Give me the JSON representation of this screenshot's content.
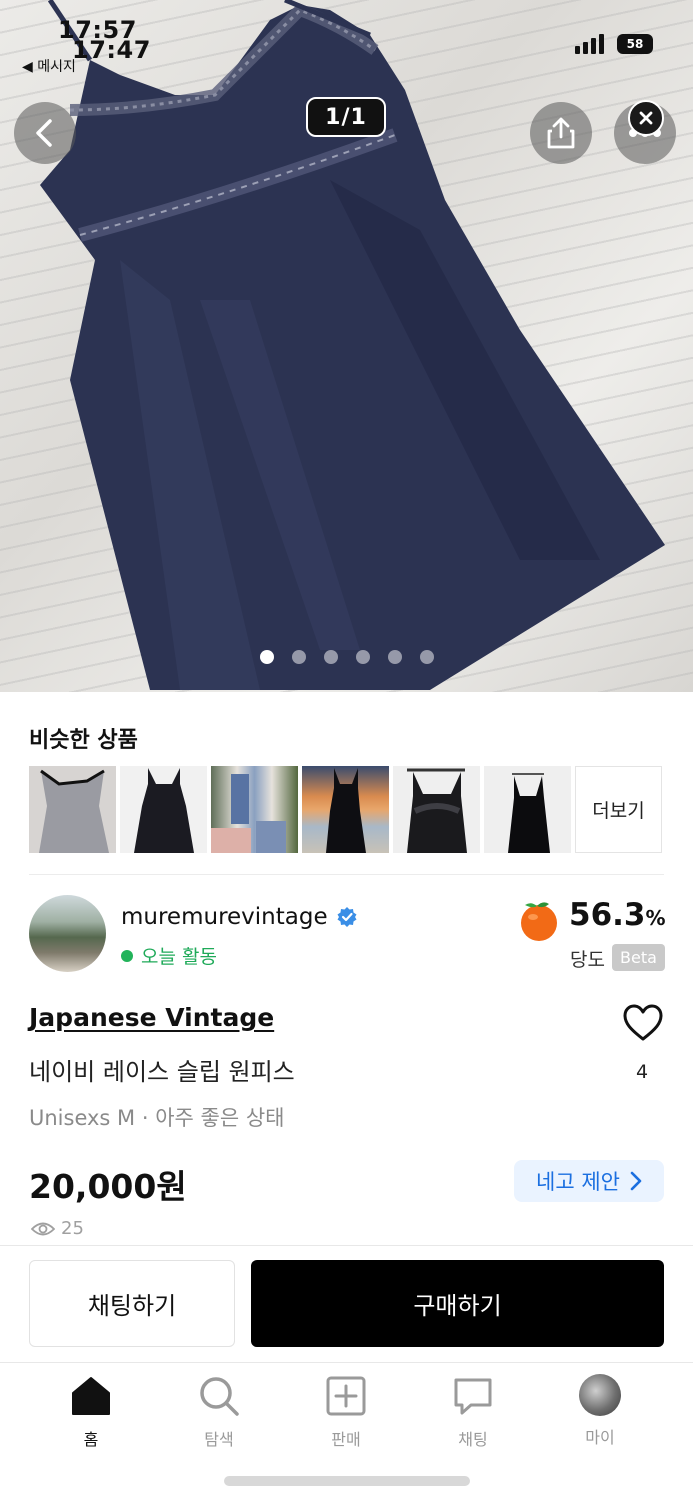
{
  "status_bar": {
    "time_primary": "17:57",
    "time_secondary": "17:47",
    "back_app": "◀ 메시지",
    "battery": "58"
  },
  "gallery": {
    "counter": "1/1",
    "total_dots": 6,
    "active_dot": 1
  },
  "similar": {
    "title": "비슷한 상품",
    "more_label": "더보기",
    "thumbs": [
      {
        "name": "grey-lace-slip"
      },
      {
        "name": "black-slip-dress"
      },
      {
        "name": "blue-outfits"
      },
      {
        "name": "black-dress-beach"
      },
      {
        "name": "black-lace-top"
      },
      {
        "name": "black-cami-dress"
      }
    ]
  },
  "seller": {
    "name": "muremurevintage",
    "activity": "오늘 활동",
    "score": "56.3",
    "score_unit": "%",
    "score_label": "당도",
    "beta": "Beta"
  },
  "product": {
    "brand": "Japanese Vintage",
    "name": "네이비 레이스 슬립 원피스",
    "meta": "Unisexs M · 아주 좋은 상태",
    "price": "20,000원",
    "likes": "4",
    "views": "25",
    "negotiate": "네고 제안"
  },
  "actions": {
    "chat": "채팅하기",
    "buy": "구매하기"
  },
  "tabs": [
    {
      "label": "홈",
      "icon": "home-icon"
    },
    {
      "label": "탐색",
      "icon": "search-icon"
    },
    {
      "label": "판매",
      "icon": "plus-square-icon"
    },
    {
      "label": "채팅",
      "icon": "chat-icon"
    },
    {
      "label": "마이",
      "icon": "profile-avatar-icon"
    }
  ],
  "colors": {
    "accent_blue": "#1b6fe0",
    "active_green": "#22b35a",
    "buy_button": "#000000"
  }
}
